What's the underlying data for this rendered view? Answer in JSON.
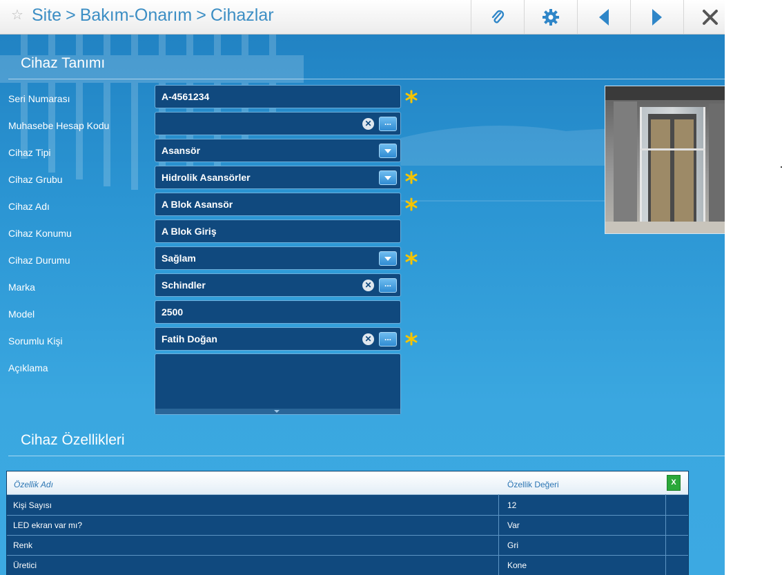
{
  "breadcrumb": {
    "items": [
      "Site",
      ">",
      "Bakım-Onarım",
      ">",
      "Cihazlar"
    ]
  },
  "toolbar": {
    "buttons": [
      "paperclip-icon",
      "gear-icon",
      "previous-arrow-icon",
      "next-arrow-icon",
      "close-icon"
    ]
  },
  "sections": {
    "definition_title": "Cihaz Tanımı",
    "properties_title": "Cihaz Özellikleri"
  },
  "form": {
    "serial_label": "Seri Numarası",
    "serial_value": "A-4561234",
    "account_label": "Muhasebe Hesap Kodu",
    "account_value": "",
    "type_label": "Cihaz Tipi",
    "type_value": "Asansör",
    "group_label": "Cihaz Grubu",
    "group_value": "Hidrolik Asansörler",
    "name_label": "Cihaz Adı",
    "name_value": "A Blok Asansör",
    "location_label": "Cihaz Konumu",
    "location_value": "A Blok Giriş",
    "status_label": "Cihaz Durumu",
    "status_value": "Sağlam",
    "brand_label": "Marka",
    "brand_value": "Schindler",
    "model_label": "Model",
    "model_value": "2500",
    "owner_label": "Sorumlu Kişi",
    "owner_value": "Fatih Doğan",
    "desc_label": "Açıklama",
    "desc_value": "",
    "lookup_button": "...",
    "clear_glyph": "✕",
    "required_marker_icon": "asterisk-icon"
  },
  "properties_table": {
    "headers": [
      "Özellik Adı",
      "Özellik Değeri"
    ],
    "export_label": "X",
    "rows": [
      {
        "name": "Kişi Sayısı",
        "value": "12"
      },
      {
        "name": "LED ekran var mı?",
        "value": "Var"
      },
      {
        "name": "Renk",
        "value": "Gri"
      },
      {
        "name": "Üretici",
        "value": "Kone"
      }
    ]
  },
  "colors": {
    "accent": "#3c8ec4",
    "field_bg": "#10497e",
    "required": "#f5c400",
    "export_green": "#2aa83a"
  }
}
